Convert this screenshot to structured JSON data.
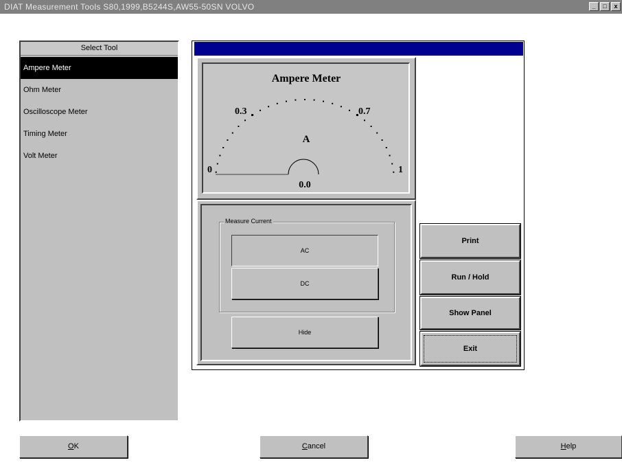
{
  "window": {
    "title": "DIAT Measurement Tools S80,1999,B5244S,AW55-50SN VOLVO",
    "minimize_glyph": "_",
    "maximize_glyph": "□",
    "close_glyph": "x"
  },
  "tool_list": {
    "header": "Select Tool",
    "items": [
      {
        "label": "Ampere Meter",
        "selected": true
      },
      {
        "label": "Ohm Meter",
        "selected": false
      },
      {
        "label": "Oscilloscope Meter",
        "selected": false
      },
      {
        "label": "Timing Meter",
        "selected": false
      },
      {
        "label": "Volt Meter",
        "selected": false
      }
    ]
  },
  "gauge": {
    "title": "Ampere Meter",
    "unit": "A",
    "scale_labels": {
      "min": "0",
      "low": "0.3",
      "high": "0.7",
      "max": "1"
    },
    "reading": "0.0",
    "value": 0.0
  },
  "measure_group": {
    "label": "Measure Current",
    "ac_label": "AC",
    "dc_label": "DC",
    "selected_mode": "AC",
    "hide_label": "Hide"
  },
  "side_buttons": {
    "print": "Print",
    "run_hold": "Run / Hold",
    "show_panel": "Show Panel",
    "exit": "Exit"
  },
  "bottom_buttons": {
    "ok_mnemonic": "O",
    "ok_rest": "K",
    "cancel_mnemonic": "C",
    "cancel_rest": "ancel",
    "help_mnemonic": "H",
    "help_rest": "elp"
  },
  "colors": {
    "title_bar": "#808080",
    "panel_gray": "#c0c0c0",
    "header_blue": "#000090",
    "selection": "#000000"
  }
}
